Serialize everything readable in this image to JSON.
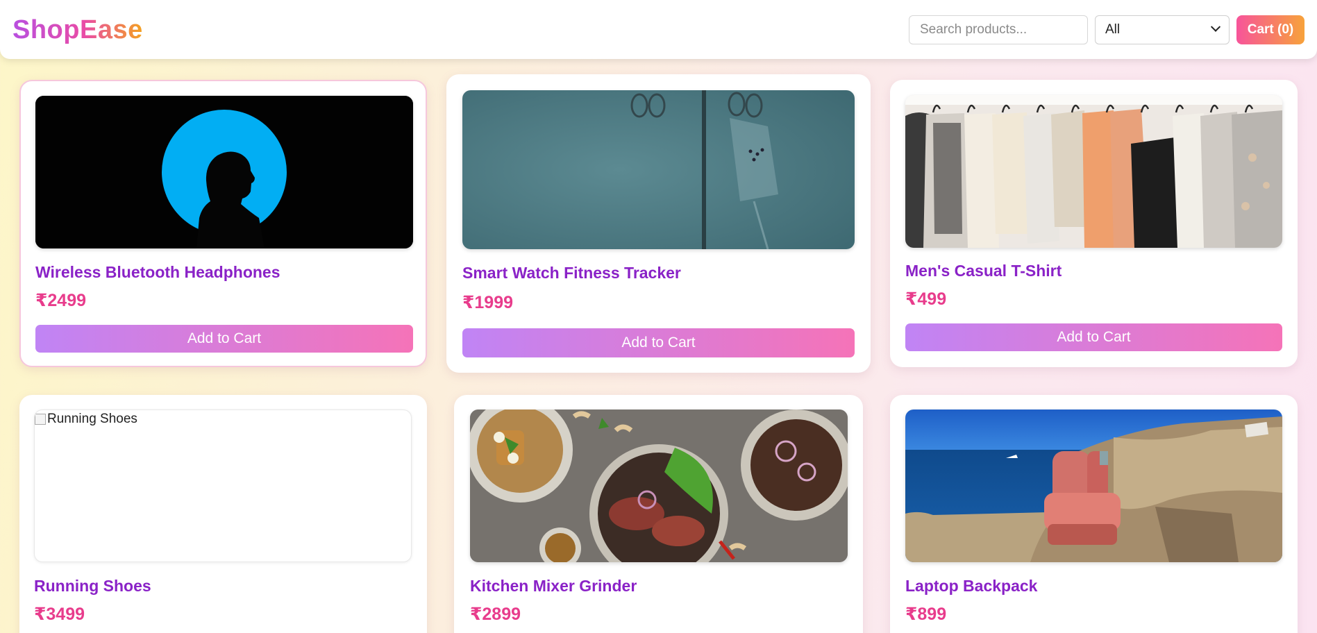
{
  "brand": {
    "logo": "ShopEase"
  },
  "search": {
    "placeholder": "Search products..."
  },
  "category": {
    "selected": "All"
  },
  "cart": {
    "label": "Cart (0)"
  },
  "colors": {
    "title": "#8a22c7",
    "price": "#e83c8c",
    "button_start": "#c084f5",
    "button_end": "#f573b8"
  },
  "products": [
    {
      "name": "Wireless Bluetooth Headphones",
      "price": "₹2499",
      "button": "Add to Cart",
      "image": "silhouette-headphones-photo"
    },
    {
      "name": "Smart Watch Fitness Tracker",
      "price": "₹1999",
      "button": "Add to Cart",
      "image": "iv-drip-photo"
    },
    {
      "name": "Men's Casual T-Shirt",
      "price": "₹499",
      "button": "Add to Cart",
      "image": "clothes-rack-photo"
    },
    {
      "name": "Running Shoes",
      "price": "₹3499",
      "image_alt": "Running Shoes",
      "image": "broken-image"
    },
    {
      "name": "Kitchen Mixer Grinder",
      "price": "₹2899",
      "image": "food-plates-photo"
    },
    {
      "name": "Laptop Backpack",
      "price": "₹899",
      "image": "chair-seaside-photo"
    }
  ]
}
